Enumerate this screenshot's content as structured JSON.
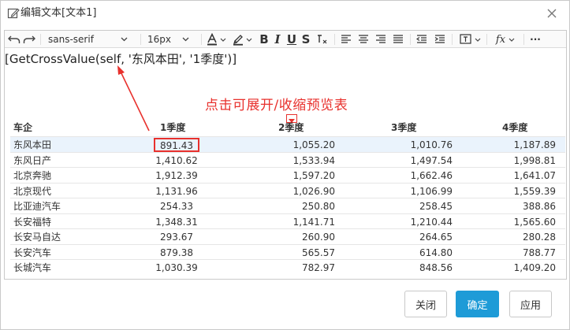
{
  "dialog": {
    "title": "编辑文本[文本1]",
    "close_glyph": "×"
  },
  "toolbar": {
    "font_family": "sans-serif",
    "font_size": "16px",
    "bold": "B",
    "italic": "I",
    "underline": "U",
    "strike": "S",
    "fx": "fx",
    "more": "···"
  },
  "editor": {
    "formula": "[GetCrossValue(self, '东风本田', '1季度')]",
    "hint": "点击可展开/收缩预览表"
  },
  "table": {
    "headers": [
      "车企",
      "1季度",
      "2季度",
      "3季度",
      "4季度"
    ],
    "rows": [
      [
        "东风本田",
        "891.43",
        "1,055.20",
        "1,010.76",
        "1,187.89"
      ],
      [
        "东风日产",
        "1,410.62",
        "1,533.94",
        "1,497.54",
        "1,998.81"
      ],
      [
        "北京奔驰",
        "1,912.39",
        "1,597.20",
        "1,662.46",
        "1,641.07"
      ],
      [
        "北京现代",
        "1,131.96",
        "1,026.90",
        "1,106.99",
        "1,559.39"
      ],
      [
        "比亚迪汽车",
        "254.33",
        "250.80",
        "258.45",
        "388.86"
      ],
      [
        "长安福特",
        "1,348.31",
        "1,141.71",
        "1,210.44",
        "1,565.60"
      ],
      [
        "长安马自达",
        "293.67",
        "260.90",
        "264.65",
        "280.28"
      ],
      [
        "长安汽车",
        "879.38",
        "565.57",
        "614.80",
        "788.77"
      ],
      [
        "长城汽车",
        "1,030.39",
        "782.97",
        "848.56",
        "1,409.20"
      ]
    ]
  },
  "footer": {
    "close_label": "关闭",
    "ok_label": "确定",
    "apply_label": "应用"
  },
  "colors": {
    "accent": "#1e9bd7",
    "annotation_red": "#e8312d",
    "highlight_row": "#eaf3fc"
  }
}
